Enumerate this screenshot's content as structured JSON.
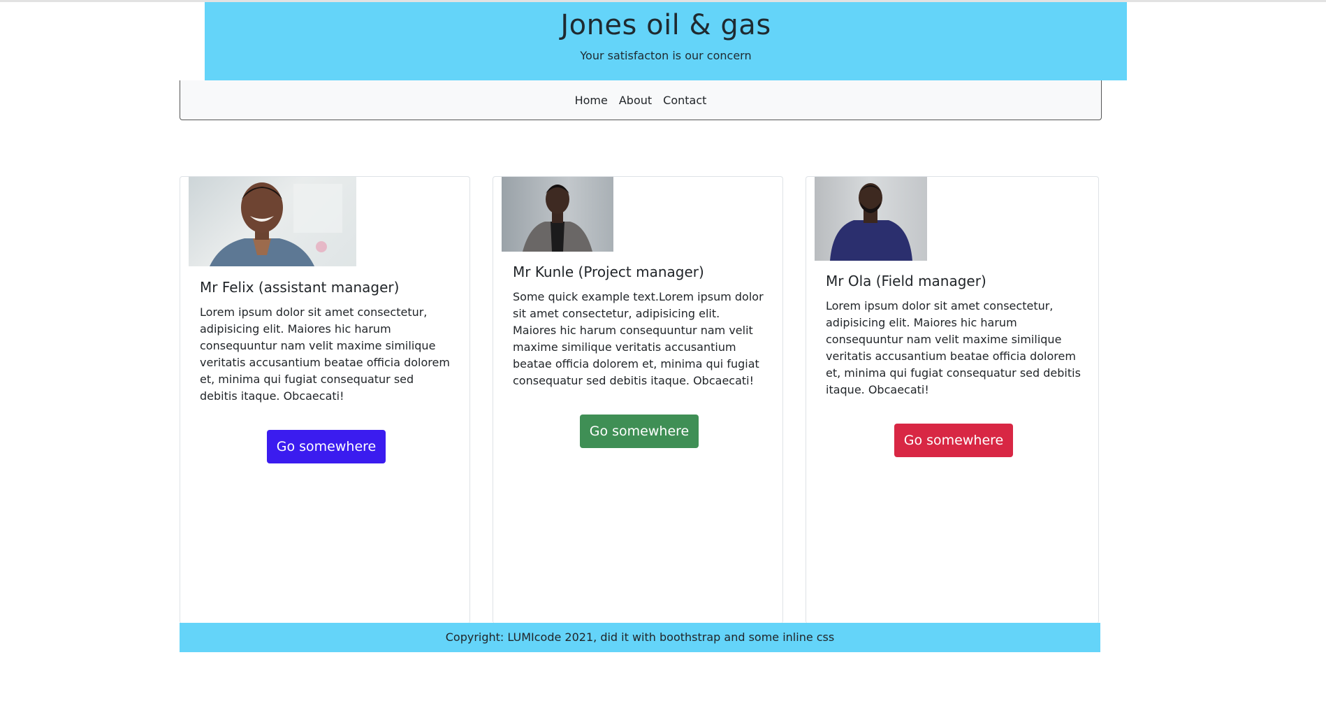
{
  "header": {
    "title": "Jones oil & gas",
    "tagline": "Your satisfacton is our concern",
    "bg_color": "#64d4f9"
  },
  "nav": {
    "items": [
      "Home",
      "About",
      "Contact"
    ]
  },
  "cards": [
    {
      "title": "Mr Felix (assistant manager)",
      "text": "Lorem ipsum dolor sit amet consectetur, adipisicing elit. Maiores hic harum consequuntur nam velit maxime similique veritatis accusantium beatae officia dolorem et, minima qui fugiat consequatur sed debitis itaque. Obcaecati!",
      "button": "Go somewhere",
      "button_color": "#3b1cef"
    },
    {
      "title": "Mr Kunle (Project manager)",
      "text": "Some quick example text.Lorem ipsum dolor sit amet consectetur, adipisicing elit. Maiores hic harum consequuntur nam velit maxime similique veritatis accusantium beatae officia dolorem et, minima qui fugiat consequatur sed debitis itaque. Obcaecati!",
      "button": "Go somewhere",
      "button_color": "#3f8f55"
    },
    {
      "title": "Mr Ola (Field manager)",
      "text": "Lorem ipsum dolor sit amet consectetur, adipisicing elit. Maiores hic harum consequuntur nam velit maxime similique veritatis accusantium beatae officia dolorem et, minima qui fugiat consequatur sed debitis itaque. Obcaecati!",
      "button": "Go somewhere",
      "button_color": "#d82744"
    }
  ],
  "footer": {
    "text": "Copyright: LUMIcode 2021, did it with boothstrap and some inline css"
  }
}
